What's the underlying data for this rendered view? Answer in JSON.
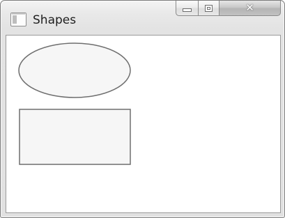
{
  "window": {
    "title": "Shapes"
  },
  "caption_buttons": {
    "minimize_icon": "minimize-icon",
    "maximize_icon": "maximize-icon",
    "close_label": "✕"
  },
  "canvas": {
    "shapes": [
      {
        "type": "ellipse",
        "fill": "#f6f6f6",
        "stroke": "#6e6e6e"
      },
      {
        "type": "rectangle",
        "fill": "#f6f6f6",
        "stroke": "#6e6e6e"
      }
    ]
  },
  "colors": {
    "shape_fill": "#f6f6f6",
    "shape_stroke": "#6e6e6e",
    "close_button": "#c4c4c4"
  }
}
